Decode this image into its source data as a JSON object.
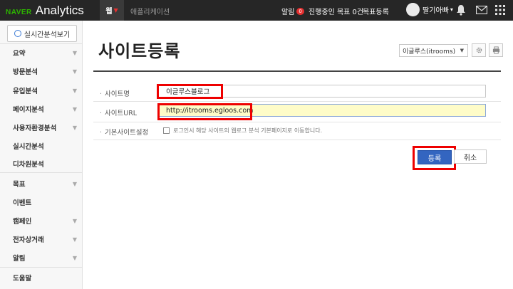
{
  "header": {
    "brand_naver": "NAVER",
    "brand_analytics": "Analytics",
    "tab_web": "웹",
    "tab_app": "애플리케이션",
    "alarm_label": "알림",
    "alarm_count": "0",
    "progress_text": "진행중인 목표 0건",
    "goal_register": "목표등록",
    "user_name": "딸기아빠",
    "user_caret": "▾"
  },
  "sidebar": {
    "realtime_button": "실시간분석보기",
    "items": [
      {
        "label": "요약",
        "arrow": true
      },
      {
        "label": "방문분석",
        "arrow": true
      },
      {
        "label": "유입분석",
        "arrow": true
      },
      {
        "label": "페이지분석",
        "arrow": true
      },
      {
        "label": "사용자환경분석",
        "arrow": true
      },
      {
        "label": "실시간분석",
        "arrow": false
      },
      {
        "label": "디차원분석",
        "arrow": false
      },
      {
        "label": "목표",
        "arrow": true
      },
      {
        "label": "이벤트",
        "arrow": false
      },
      {
        "label": "캠페인",
        "arrow": true
      },
      {
        "label": "전자상거래",
        "arrow": true
      },
      {
        "label": "알림",
        "arrow": true
      },
      {
        "label": "도움말",
        "arrow": false
      }
    ]
  },
  "main": {
    "title": "사이트등록",
    "site_select_value": "이글루스(itrooms)",
    "form": {
      "site_name_label": "사이트명",
      "site_name_value": "이글루스블로그",
      "site_url_label": "사이트URL",
      "site_url_value": "http://itrooms.egloos.com",
      "default_site_label": "기본사이트설정",
      "default_site_text": "로그인시 해당 사이트의 웹로그 분석 기본페이지로 이동합니다."
    },
    "register_button": "등록",
    "cancel_button": "취소"
  },
  "colors": {
    "topbar": "#262626",
    "brand_green": "#2db400",
    "accent_blue": "#3365c0",
    "highlight_red": "#ee0000",
    "url_field_bg": "#fefcc8"
  }
}
